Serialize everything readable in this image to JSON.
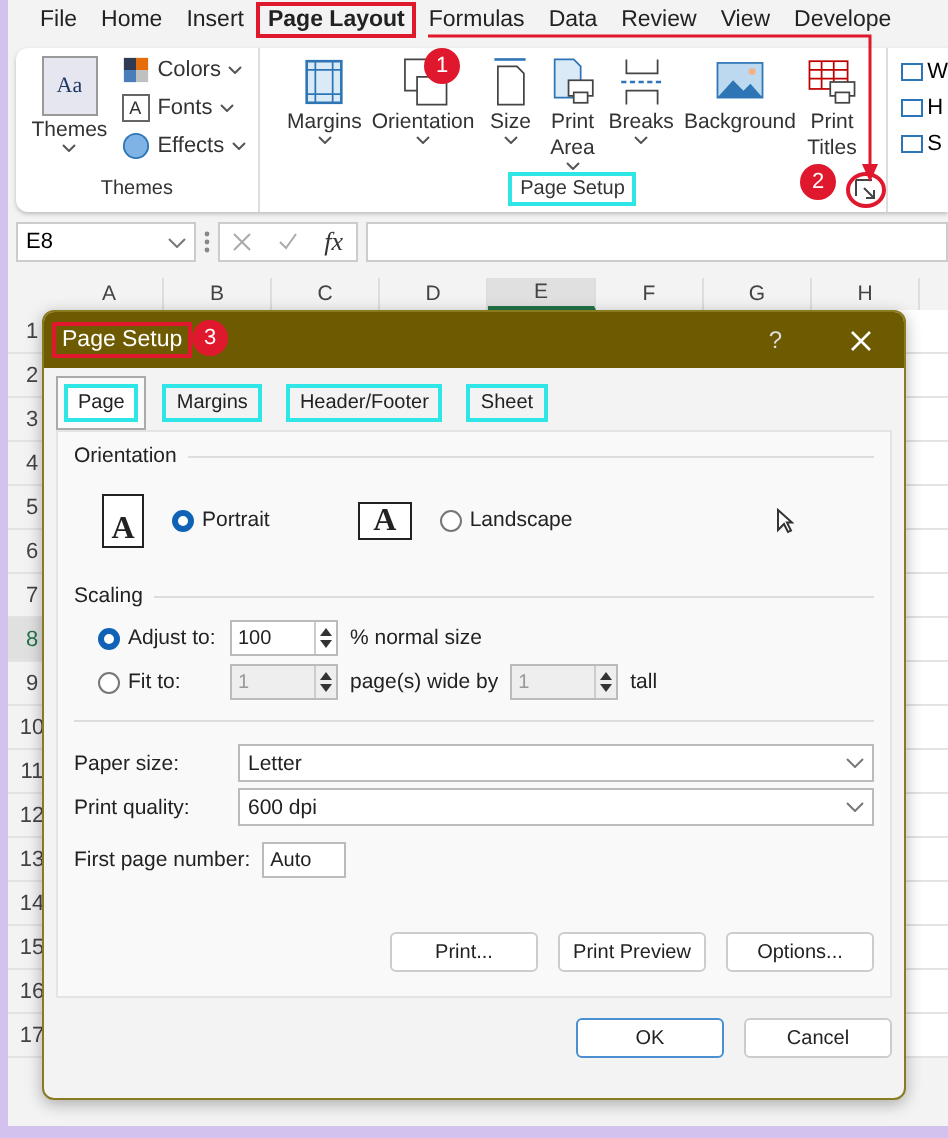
{
  "menu_tabs": [
    {
      "label": "File",
      "selected": false
    },
    {
      "label": "Home",
      "selected": false
    },
    {
      "label": "Insert",
      "selected": false
    },
    {
      "label": "Page Layout",
      "selected": true
    },
    {
      "label": "Formulas",
      "selected": false
    },
    {
      "label": "Data",
      "selected": false
    },
    {
      "label": "Review",
      "selected": false
    },
    {
      "label": "View",
      "selected": false
    },
    {
      "label": "Develope",
      "selected": false
    }
  ],
  "ribbon": {
    "themes_group": {
      "label": "Themes",
      "big_button": "Themes",
      "icon_text": "Aa",
      "small_buttons": [
        {
          "kind": "colors",
          "label": "Colors"
        },
        {
          "kind": "fonts",
          "label": "Fonts",
          "icon_text": "A"
        },
        {
          "kind": "effects",
          "label": "Effects"
        }
      ]
    },
    "page_setup_group": {
      "label": "Page Setup",
      "buttons": [
        {
          "kind": "margins",
          "lines": [
            "Margins"
          ],
          "dropdown": true
        },
        {
          "kind": "orientation",
          "lines": [
            "Orientation"
          ],
          "dropdown": true
        },
        {
          "kind": "size",
          "lines": [
            "Size"
          ],
          "dropdown": true
        },
        {
          "kind": "print_area",
          "lines": [
            "Print",
            "Area"
          ],
          "dropdown": true
        },
        {
          "kind": "breaks",
          "lines": [
            "Breaks"
          ],
          "dropdown": true
        },
        {
          "kind": "background",
          "lines": [
            "Background"
          ],
          "dropdown": false
        },
        {
          "kind": "print_titles",
          "lines": [
            "Print",
            "Titles"
          ],
          "dropdown": false
        }
      ]
    },
    "cut_group": [
      "W",
      "H",
      "S"
    ]
  },
  "formula_bar": {
    "name_box": "E8",
    "fx": "fx"
  },
  "grid": {
    "columns": [
      {
        "label": "A",
        "selected": false
      },
      {
        "label": "B",
        "selected": false
      },
      {
        "label": "C",
        "selected": false
      },
      {
        "label": "D",
        "selected": false
      },
      {
        "label": "E",
        "selected": true
      },
      {
        "label": "F",
        "selected": false
      },
      {
        "label": "G",
        "selected": false
      },
      {
        "label": "H",
        "selected": false
      }
    ],
    "rows": [
      {
        "label": "1",
        "selected": false
      },
      {
        "label": "2",
        "selected": false
      },
      {
        "label": "3",
        "selected": false
      },
      {
        "label": "4",
        "selected": false
      },
      {
        "label": "5",
        "selected": false
      },
      {
        "label": "6",
        "selected": false
      },
      {
        "label": "7",
        "selected": false
      },
      {
        "label": "8",
        "selected": true
      },
      {
        "label": "9",
        "selected": false
      },
      {
        "label": "10",
        "selected": false
      },
      {
        "label": "11",
        "selected": false
      },
      {
        "label": "12",
        "selected": false
      },
      {
        "label": "13",
        "selected": false
      },
      {
        "label": "14",
        "selected": false
      },
      {
        "label": "15",
        "selected": false
      },
      {
        "label": "16",
        "selected": false
      },
      {
        "label": "17",
        "selected": false
      }
    ]
  },
  "dialog": {
    "title": "Page Setup",
    "help": "?",
    "tabs": [
      {
        "label": "Page",
        "selected": true
      },
      {
        "label": "Margins",
        "selected": false
      },
      {
        "label": "Header/Footer",
        "selected": false
      },
      {
        "label": "Sheet",
        "selected": false
      }
    ],
    "orientation": {
      "label": "Orientation",
      "options": [
        {
          "kind": "portrait",
          "icon_letter": "A",
          "label": "Portrait",
          "selected": true
        },
        {
          "kind": "landscape",
          "icon_letter": "A",
          "label": "Landscape",
          "selected": false
        }
      ]
    },
    "scaling": {
      "label": "Scaling",
      "adjust": {
        "label": "Adjust to:",
        "selected": true,
        "value": "100",
        "suffix": "% normal size"
      },
      "fit": {
        "label": "Fit to:",
        "selected": false,
        "wide_value": "1",
        "wide_suffix": "page(s) wide by",
        "tall_value": "1",
        "tall_suffix": "tall"
      }
    },
    "paper_size": {
      "label": "Paper size:",
      "value": "Letter"
    },
    "print_quality": {
      "label": "Print quality:",
      "value": "600 dpi"
    },
    "first_page_number": {
      "label": "First page number:",
      "value": "Auto"
    },
    "panel_buttons": [
      "Print...",
      "Print Preview",
      "Options..."
    ],
    "buttons": [
      {
        "label": "OK",
        "default": true
      },
      {
        "label": "Cancel",
        "default": false
      }
    ]
  },
  "annotations": [
    {
      "label": "1"
    },
    {
      "label": "2"
    },
    {
      "label": "3"
    }
  ]
}
